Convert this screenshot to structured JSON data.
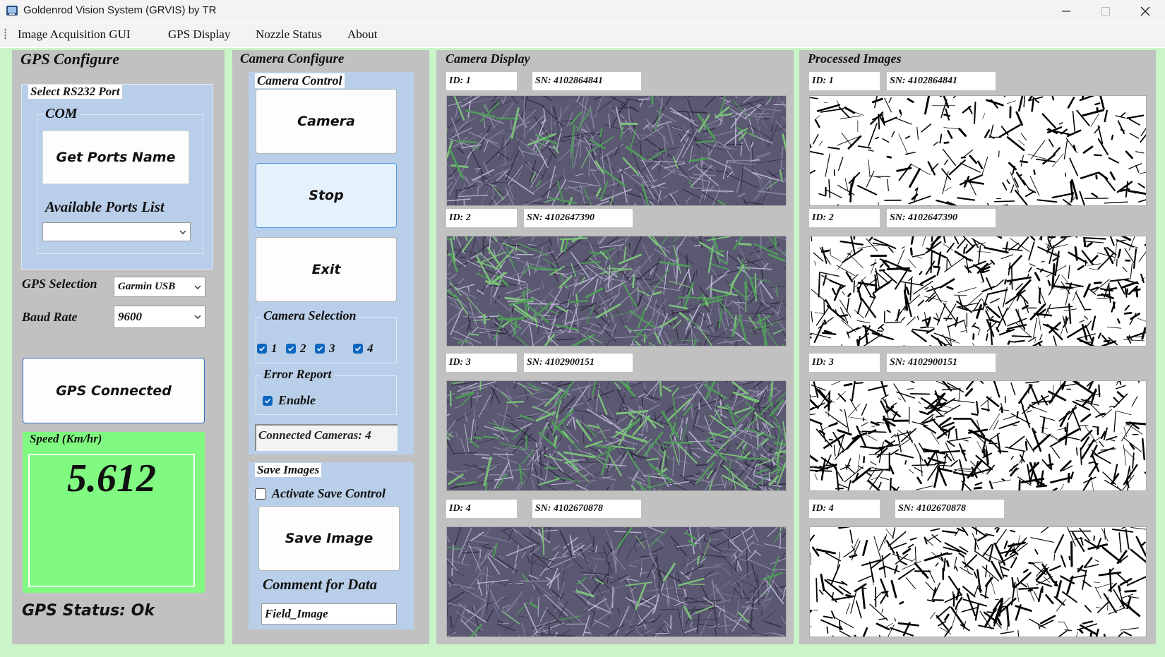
{
  "window": {
    "title": "Goldenrod Vision System (GRVIS) by TR"
  },
  "menu": [
    "Image Acquisition GUI",
    "GPS Display",
    "Nozzle Status",
    "About"
  ],
  "gps_panel": {
    "title": "GPS Configure",
    "rs232_group": "Select RS232 Port",
    "com_group": "COM",
    "get_ports_button": "Get Ports Name",
    "available_ports_label": "Available Ports List",
    "available_ports_value": "",
    "gps_selection_label": "GPS Selection",
    "gps_selection_value": "Garmin USB",
    "baud_rate_label": "Baud Rate",
    "baud_rate_value": "9600",
    "gps_connected_button": "GPS Connected",
    "speed_label": "Speed (Km/hr)",
    "speed_value": "5.612",
    "status": "GPS Status: Ok"
  },
  "camera_panel": {
    "title": "Camera Configure",
    "control_group": "Camera Control",
    "camera_button": "Camera",
    "stop_button": "Stop",
    "exit_button": "Exit",
    "selection_group": "Camera Selection",
    "cameras": [
      {
        "label": "1",
        "checked": true
      },
      {
        "label": "2",
        "checked": true
      },
      {
        "label": "3",
        "checked": true
      },
      {
        "label": "4",
        "checked": true
      }
    ],
    "error_group": "Error Report",
    "error_enable_label": "Enable",
    "error_enable_checked": true,
    "connected_cameras": "Connected Cameras: 4",
    "save_group": "Save Images",
    "activate_save_label": "Activate Save Control",
    "activate_save_checked": false,
    "save_image_button": "Save Image",
    "comment_label": "Comment for Data",
    "comment_value": "Field_Image"
  },
  "camera_display": {
    "title": "Camera Display",
    "feeds": [
      {
        "id": "ID: 1",
        "sn": "SN: 4102864841"
      },
      {
        "id": "ID: 2",
        "sn": "SN: 4102647390"
      },
      {
        "id": "ID: 3",
        "sn": "SN: 4102900151"
      },
      {
        "id": "ID: 4",
        "sn": "SN: 4102670878"
      }
    ]
  },
  "processed_images": {
    "title": "Processed Images",
    "feeds": [
      {
        "id": "ID: 1",
        "sn": "SN: 4102864841"
      },
      {
        "id": "ID: 2",
        "sn": "SN: 4102647390"
      },
      {
        "id": "ID: 3",
        "sn": "SN: 4102900151"
      },
      {
        "id": "ID: 4",
        "sn": "SN: 4102670878"
      }
    ]
  },
  "colors": {
    "frame_green": "#c9f5c9",
    "panel_gray": "#c1c1c1",
    "group_blue": "#b9cfe9",
    "speed_green": "#80fa80",
    "checkbox_blue": "#0d67c0"
  }
}
